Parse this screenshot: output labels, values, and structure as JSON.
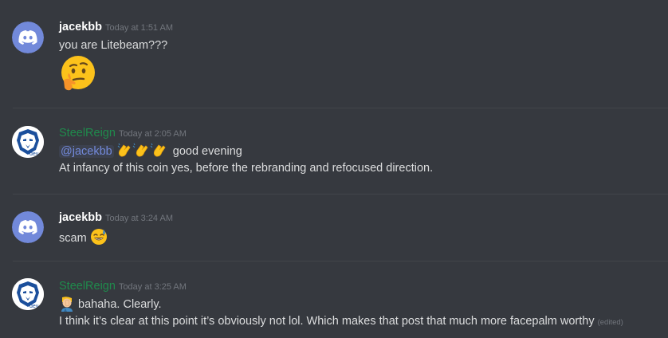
{
  "messages": [
    {
      "username": "jacekbb",
      "timestamp": "Today at 1:51 AM",
      "text": "you are Litebeam???",
      "emoji": "thinking-face"
    },
    {
      "username": "SteelReign",
      "timestamp": "Today at 2:05 AM",
      "mention": "@jacekbb",
      "line1_after": "good evening",
      "line2": "At infancy of this coin yes, before the rebranding and refocused direction."
    },
    {
      "username": "jacekbb",
      "timestamp": "Today at 3:24 AM",
      "text": "scam"
    },
    {
      "username": "SteelReign",
      "timestamp": "Today at 3:25 AM",
      "line1": "bahaha. Clearly.",
      "line2": "I think it’s clear at this point it’s obviously not lol. Which makes that post that much more facepalm worthy",
      "edited": "(edited)"
    }
  ],
  "colors": {
    "background": "#36393f",
    "username_default": "#ffffff",
    "username_role": "#1f8b4c",
    "mention": "#7289da",
    "timestamp": "#72767d",
    "discord_blurple": "#7289da"
  }
}
